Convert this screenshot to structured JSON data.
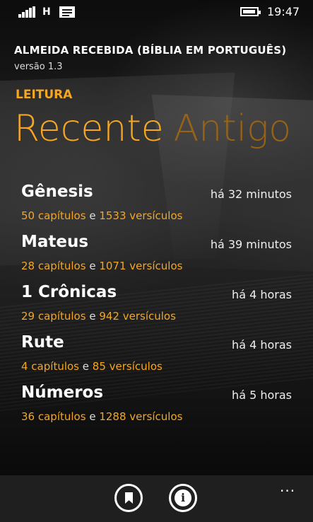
{
  "status_bar": {
    "network": "H",
    "time": "19:47"
  },
  "app": {
    "title": "ALMEIDA RECEBIDA (BÍBLIA EM PORTUGUÊS)",
    "version": "versão 1.3"
  },
  "section": "LEITURA",
  "pivot": {
    "active": "Recente",
    "next": "Antigo"
  },
  "connector": "e",
  "items": [
    {
      "book": "Gênesis",
      "time": "há 32 minutos",
      "chapters": "50 capítulos",
      "verses": "1533 versículos"
    },
    {
      "book": "Mateus",
      "time": "há 39 minutos",
      "chapters": "28 capítulos",
      "verses": "1071 versículos"
    },
    {
      "book": "1 Crônicas",
      "time": "há 4 horas",
      "chapters": "29 capítulos",
      "verses": "942 versículos"
    },
    {
      "book": "Rute",
      "time": "há 4 horas",
      "chapters": "4 capítulos",
      "verses": "85 versículos"
    },
    {
      "book": "Números",
      "time": "há 5 horas",
      "chapters": "36 capítulos",
      "verses": "1288 versículos"
    }
  ],
  "app_bar": {
    "more": "..."
  },
  "colors": {
    "accent": "#f5a623",
    "app_bar": "#1f1f1f"
  },
  "icons": [
    "signal-icon",
    "message-icon",
    "battery-icon",
    "bookmark-icon",
    "info-icon",
    "more-icon"
  ]
}
